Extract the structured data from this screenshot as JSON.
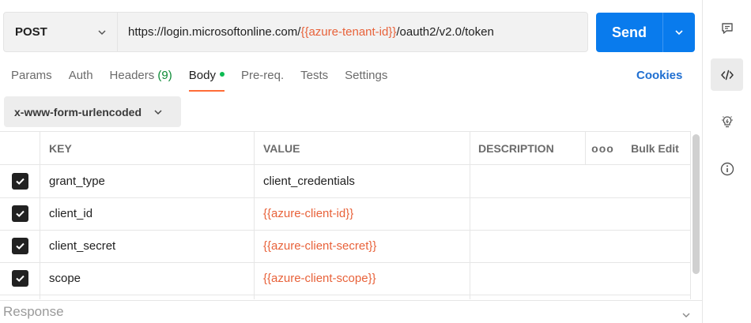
{
  "request": {
    "method": "POST",
    "url_parts": [
      {
        "text": "https://login.microsoftonline.com/",
        "var": false
      },
      {
        "text": "{{azure-tenant-id}}",
        "var": true
      },
      {
        "text": "/oauth2/v2.0/token",
        "var": false
      }
    ],
    "send_label": "Send"
  },
  "tabs": {
    "params": "Params",
    "auth": "Auth",
    "headers": "Headers",
    "headers_count": "(9)",
    "body": "Body",
    "prereq": "Pre-req.",
    "tests": "Tests",
    "settings": "Settings",
    "cookies": "Cookies"
  },
  "body_type": "x-www-form-urlencoded",
  "table": {
    "headers": {
      "key": "KEY",
      "value": "VALUE",
      "description": "DESCRIPTION",
      "more": "ooo",
      "bulk_edit": "Bulk Edit"
    },
    "rows": [
      {
        "checked": true,
        "key": "grant_type",
        "value": "client_credentials",
        "value_is_var": false,
        "description": ""
      },
      {
        "checked": true,
        "key": "client_id",
        "value": "{{azure-client-id}}",
        "value_is_var": true,
        "description": ""
      },
      {
        "checked": true,
        "key": "client_secret",
        "value": "{{azure-client-secret}}",
        "value_is_var": true,
        "description": ""
      },
      {
        "checked": true,
        "key": "scope",
        "value": "{{azure-client-scope}}",
        "value_is_var": true,
        "description": ""
      }
    ]
  },
  "response": {
    "label": "Response"
  },
  "rail": [
    "comment-icon",
    "code-icon",
    "lightbulb-icon",
    "info-icon"
  ],
  "colors": {
    "accent": "#ff6c37",
    "send": "#097bed",
    "variable": "#e8623a",
    "link": "#1f6fd1"
  }
}
